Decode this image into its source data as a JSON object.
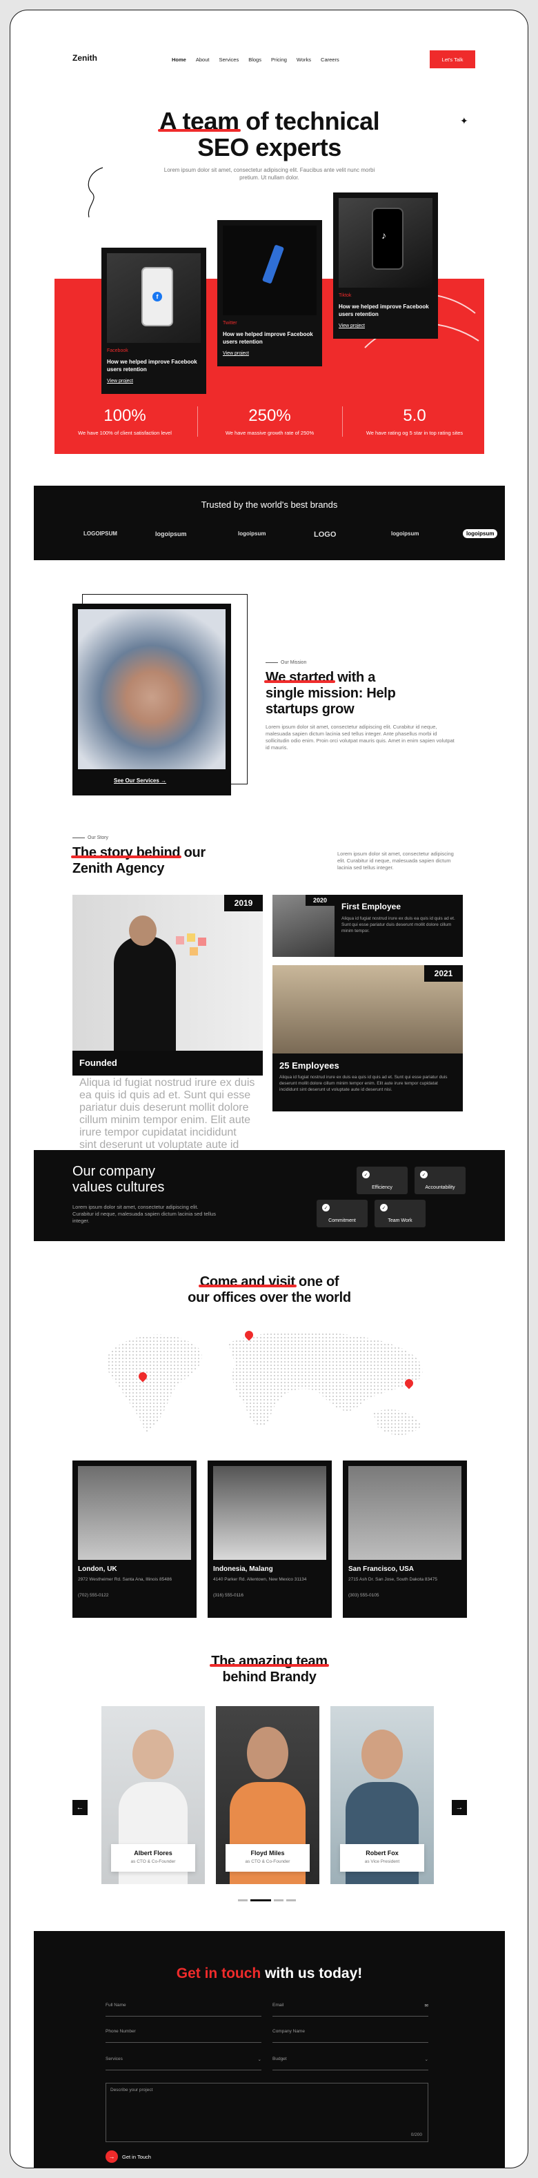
{
  "nav": {
    "logo": "Zenith",
    "items": [
      "Home",
      "About",
      "Services",
      "Blogs",
      "Pricing",
      "Works",
      "Careers"
    ],
    "cta": "Let's Talk"
  },
  "hero": {
    "title_highlight": "A team",
    "title_rest_1": " of technical",
    "title_line_2": "SEO experts",
    "subtitle": "Lorem ipsum dolor sit amet, consectetur adipiscing elit. Faucibus ante velit nunc morbi pretium. Ut nullam dolor.",
    "cards": [
      {
        "tag": "Facebook",
        "title": "How we helped improve Facebook users retention",
        "link": "View project"
      },
      {
        "tag": "Twitter",
        "title": "How we helped improve Facebook users retention",
        "link": "View project"
      },
      {
        "tag": "Tiktok",
        "title": "How we helped improve Facebook users retention",
        "link": "View project"
      }
    ],
    "stats": [
      {
        "value": "100%",
        "desc": "We have 100% of client satisfaction level"
      },
      {
        "value": "250%",
        "desc": "We have massive growth rate of 250%"
      },
      {
        "value": "5.0",
        "desc": "We have rating og 5 star in top rating sites"
      }
    ]
  },
  "brands": {
    "title": "Trusted by the world's best brands",
    "logos": [
      "LOGOIPSUM",
      "logoipsum",
      "logoipsum",
      "LOGO",
      "logoipsum",
      "logoipsum"
    ]
  },
  "mission": {
    "button": "See Our Services",
    "kicker": "Our Mission",
    "title_highlight": "We started",
    "title_rest_1": " with a",
    "title_line_2": "single mission: Help",
    "title_line_3": "startups grow",
    "body": "Lorem ipsum dolor sit amet, consectetur adipiscing elit. Curabitur id neque, malesuada sapien dictum lacinia sed tellus integer. Ante phasellus morbi id sollicitudin odio enim. Proin orci volutpat mauris quis. Amet in enim sapien volutpat id mauris."
  },
  "story": {
    "kicker": "Our Story",
    "title_highlight": "The story behind",
    "title_rest_1": " our",
    "title_line_2": "Zenith Agency",
    "body": "Lorem ipsum dolor sit amet, consectetur adipiscing elit. Curabitur id neque, malesuada sapien dictum lacinia sed tellus integer.",
    "cards": [
      {
        "year": "2019",
        "title": "Founded",
        "desc": "Aliqua id fugiat nostrud irure ex duis ea quis id quis ad et. Sunt qui esse pariatur duis deserunt mollit dolore cillum minim tempor enim. Elit aute irure tempor cupidatat incididunt sint deserunt ut voluptate aute id deserunt nisi."
      },
      {
        "year": "2020",
        "title": "First Employee",
        "desc": "Aliqua id fugiat nostrud irure ex duis ea quis id quis ad et. Sunt qui esse pariatur duis deserunt mollit dolore cillum minim tempor."
      },
      {
        "year": "2021",
        "title": "25 Employees",
        "desc": "Aliqua id fugiat nostrud irure ex duis ea quis id quis ad et. Sunt qui esse pariatur duis deserunt mollit dolore cillum minim tempor enim. Elit aute irure tempor cupidatat incididunt sint deserunt ut voluptate aute id deserunt nisi."
      }
    ]
  },
  "culture": {
    "title_line_1": "Our company",
    "title_line_2": "values cultures",
    "body": "Lorem ipsum dolor sit amet, consectetur adipiscing elit. Curabitur id neque, malesuada sapien dictum lacinia sed tellus integer.",
    "chips": [
      "Efficiency",
      "Accountability",
      "Commitment",
      "Team Work"
    ]
  },
  "offices": {
    "title_highlight": "Come and visit",
    "title_rest_1": " one of",
    "title_line_2": "our offices over the world",
    "items": [
      {
        "name": "London, UK",
        "address": "2972 Westheimer Rd. Santa Ana, Illinois 85486",
        "phone": "(702) 555-0122"
      },
      {
        "name": "Indonesia, Malang",
        "address": "4140 Parker Rd. Allentown, New Mexico 31134",
        "phone": "(316) 555-0116"
      },
      {
        "name": "San Francisco, USA",
        "address": "2715 Ash Dr. San Jose, South Dakota 83475",
        "phone": "(303) 555-0105"
      }
    ]
  },
  "team": {
    "title_highlight": "The amazing team",
    "title_line_2": "behind Brandy",
    "members": [
      {
        "name": "Albert Flores",
        "role": "as CTO & Co-Founder"
      },
      {
        "name": "Floyd Miles",
        "role": "as CTO & Co-Founder"
      },
      {
        "name": "Robert Fox",
        "role": "as Vice President"
      }
    ],
    "prev": "←",
    "next": "→"
  },
  "contact": {
    "title_red": "Get in touch",
    "title_rest": " with us today!",
    "fields": {
      "full_name": "Full Name",
      "email": "Email",
      "phone": "Phone Number",
      "company": "Company Name",
      "services": "Services",
      "budget": "Budget",
      "project": "Describe your project",
      "counter": "0/200"
    },
    "submit": "Get in Touch"
  },
  "colors": {
    "accent": "#ef2b2b",
    "dark": "#0d0d0d"
  }
}
